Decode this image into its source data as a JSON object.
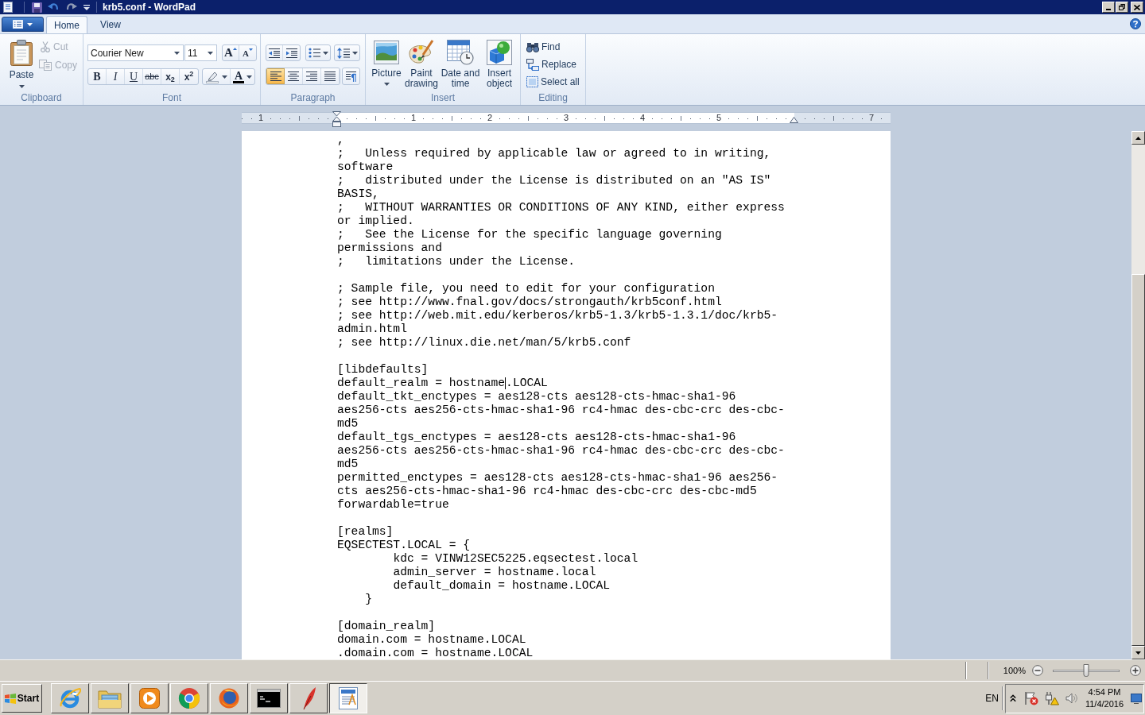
{
  "title_bar": {
    "title": "krb5.conf - WordPad"
  },
  "ribbon_tabs": [
    {
      "label": "Home",
      "selected": true
    },
    {
      "label": "View",
      "selected": false
    }
  ],
  "clipboard": {
    "label": "Clipboard",
    "paste": {
      "label": "Paste"
    },
    "small": [
      {
        "kind": "cut",
        "label": "Cut",
        "disabled": true
      },
      {
        "kind": "copy",
        "label": "Copy",
        "disabled": true
      }
    ]
  },
  "font": {
    "label": "Font",
    "family": "Courier New",
    "size": "11",
    "size_buttons": [
      {
        "kind": "grow",
        "glyph": "A"
      },
      {
        "kind": "shrink",
        "glyph": "A"
      }
    ],
    "format_buttons": [
      {
        "kind": "bold",
        "glyph": "B"
      },
      {
        "kind": "italic",
        "glyph": "I"
      },
      {
        "kind": "underline",
        "glyph": "U"
      },
      {
        "kind": "strike",
        "glyph": "abc"
      },
      {
        "kind": "sub",
        "glyph": "x$_{2}$"
      },
      {
        "kind": "super",
        "glyph": "x$^{2}$"
      }
    ],
    "color_button": {
      "glyph": "A"
    }
  },
  "paragraph": {
    "label": "Paragraph",
    "alignment": [
      {
        "kind": "left",
        "selected": true
      },
      {
        "kind": "center",
        "selected": false
      },
      {
        "kind": "right",
        "selected": false
      },
      {
        "kind": "justify",
        "selected": false
      }
    ]
  },
  "insert": {
    "label": "Insert",
    "buttons": [
      {
        "kind": "picture",
        "label": "Picture"
      },
      {
        "kind": "paint",
        "label": "Paint drawing"
      },
      {
        "kind": "datetime",
        "label": "Date and time"
      },
      {
        "kind": "object",
        "label": "Insert object"
      }
    ]
  },
  "editing": {
    "label": "Editing",
    "buttons": [
      {
        "kind": "find",
        "label": "Find"
      },
      {
        "kind": "replace",
        "label": "Replace"
      },
      {
        "kind": "select",
        "label": "Select all"
      }
    ]
  },
  "ruler": {
    "numbers": [
      "1",
      "1",
      "2",
      "3",
      "4",
      "5",
      "7"
    ]
  },
  "document": {
    "blocks": [
      {
        "lines": [
          ",",
          ";   Unless required by applicable law or agreed to in writing,",
          "software",
          ";   distributed under the License is distributed on an \"AS IS\"",
          "BASIS,",
          ";   WITHOUT WARRANTIES OR CONDITIONS OF ANY KIND, either express",
          "or implied.",
          ";   See the License for the specific language governing",
          "permissions and",
          ";   limitations under the License."
        ]
      },
      {
        "lines": [
          "; Sample file, you need to edit for your configuration",
          "; see http://www.fnal.gov/docs/strongauth/krb5conf.html",
          "; see http://web.mit.edu/kerberos/krb5-1.3/krb5-1.3.1/doc/krb5-",
          "admin.html",
          "; see http://linux.die.net/man/5/krb5.conf"
        ]
      },
      {
        "lines": [
          "[libdefaults]",
          {
            "kind": "caret",
            "before": "default_realm = hostname",
            "after": ".LOCAL"
          },
          "default_tkt_enctypes = aes128-cts aes128-cts-hmac-sha1-96",
          "aes256-cts aes256-cts-hmac-sha1-96 rc4-hmac des-cbc-crc des-cbc-",
          "md5",
          "default_tgs_enctypes = aes128-cts aes128-cts-hmac-sha1-96",
          "aes256-cts aes256-cts-hmac-sha1-96 rc4-hmac des-cbc-crc des-cbc-",
          "md5",
          "permitted_enctypes = aes128-cts aes128-cts-hmac-sha1-96 aes256-",
          "cts aes256-cts-hmac-sha1-96 rc4-hmac des-cbc-crc des-cbc-md5",
          "forwardable=true"
        ]
      },
      {
        "lines": [
          "[realms]",
          "EQSECTEST.LOCAL = {",
          "        kdc = VINW12SEC5225.eqsectest.local",
          "        admin_server = hostname.local",
          "        default_domain = hostname.LOCAL",
          "    }"
        ]
      },
      {
        "lines": [
          "[domain_realm]",
          "domain.com = hostname.LOCAL",
          ".domain.com = hostname.LOCAL"
        ]
      }
    ]
  },
  "status_bar": {
    "zoom": {
      "reading": "100%",
      "level": 0.5
    }
  },
  "taskbar": {
    "start": "Start",
    "buttons": [
      {
        "kind": "ie",
        "selected": false
      },
      {
        "kind": "explorer",
        "selected": false
      },
      {
        "kind": "media",
        "selected": false
      },
      {
        "kind": "chrome",
        "selected": false
      },
      {
        "kind": "firefox",
        "selected": false
      },
      {
        "kind": "cmd",
        "selected": false
      },
      {
        "kind": "pen",
        "selected": false
      },
      {
        "kind": "wordpad",
        "selected": true
      }
    ],
    "language": "EN",
    "time": "4:54 PM",
    "date": "11/4/2016"
  }
}
